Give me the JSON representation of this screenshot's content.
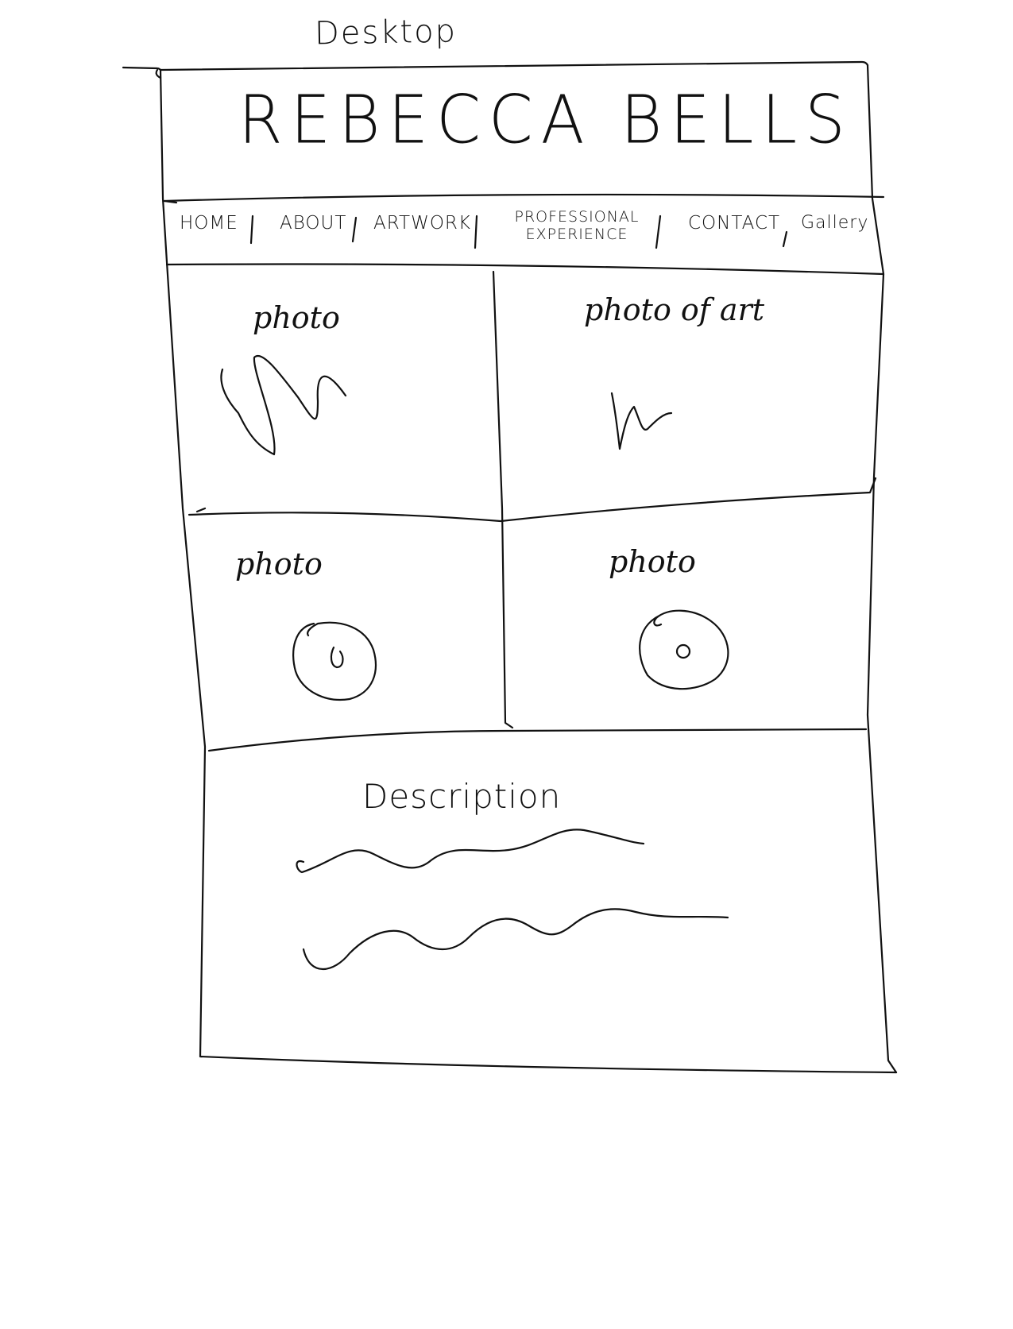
{
  "page_label": "Desktop",
  "header": {
    "title": "REBECCA BELLS"
  },
  "nav": {
    "items": [
      {
        "label": "HOME"
      },
      {
        "label": "ABOUT"
      },
      {
        "label": "ARTWORK"
      },
      {
        "label": "PROFESSIONAL EXPERIENCE"
      },
      {
        "label": "CONTACT"
      },
      {
        "label": "Gallery"
      }
    ]
  },
  "grid": {
    "cells": [
      {
        "label": "photo"
      },
      {
        "label": "photo of art"
      },
      {
        "label": "photo"
      },
      {
        "label": "photo"
      }
    ]
  },
  "description": {
    "label": "Description"
  }
}
